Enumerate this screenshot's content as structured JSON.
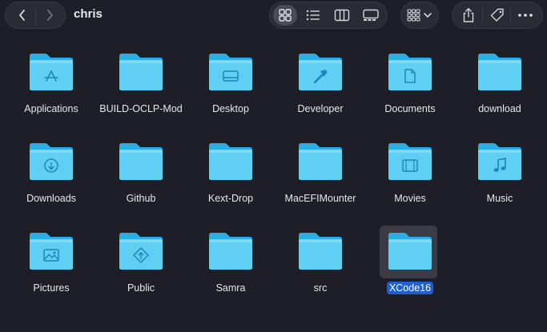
{
  "window": {
    "title": "chris"
  },
  "toolbar": {
    "back_icon": "chevron-left-icon",
    "forward_icon": "chevron-right-icon",
    "views": [
      "grid-icon",
      "list-icon",
      "columns-icon",
      "gallery-icon"
    ],
    "active_view": "grid-icon",
    "group_icon": "group-by-icon",
    "actions": [
      "share-icon",
      "tag-icon",
      "more-icon"
    ]
  },
  "colors": {
    "background": "#1e1f26",
    "folder_light": "#5fd0f3",
    "folder_dark": "#2aaee4",
    "selection": "#1f5fcf"
  },
  "files": [
    {
      "name": "Applications",
      "badge": "app-store-icon"
    },
    {
      "name": "BUILD-OCLP-Mod",
      "badge": ""
    },
    {
      "name": "Desktop",
      "badge": "desktop-icon"
    },
    {
      "name": "Developer",
      "badge": "hammer-icon"
    },
    {
      "name": "Documents",
      "badge": "document-icon"
    },
    {
      "name": "download",
      "badge": ""
    },
    {
      "name": "Downloads",
      "badge": "download-icon"
    },
    {
      "name": "Github",
      "badge": ""
    },
    {
      "name": "Kext-Drop",
      "badge": ""
    },
    {
      "name": "MacEFIMounter",
      "badge": ""
    },
    {
      "name": "Movies",
      "badge": "film-icon"
    },
    {
      "name": "Music",
      "badge": "music-note-icon"
    },
    {
      "name": "Pictures",
      "badge": "photo-icon"
    },
    {
      "name": "Public",
      "badge": "public-icon"
    },
    {
      "name": "Samra",
      "badge": ""
    },
    {
      "name": "src",
      "badge": ""
    },
    {
      "name": "XCode16",
      "badge": "",
      "selected": true
    }
  ]
}
